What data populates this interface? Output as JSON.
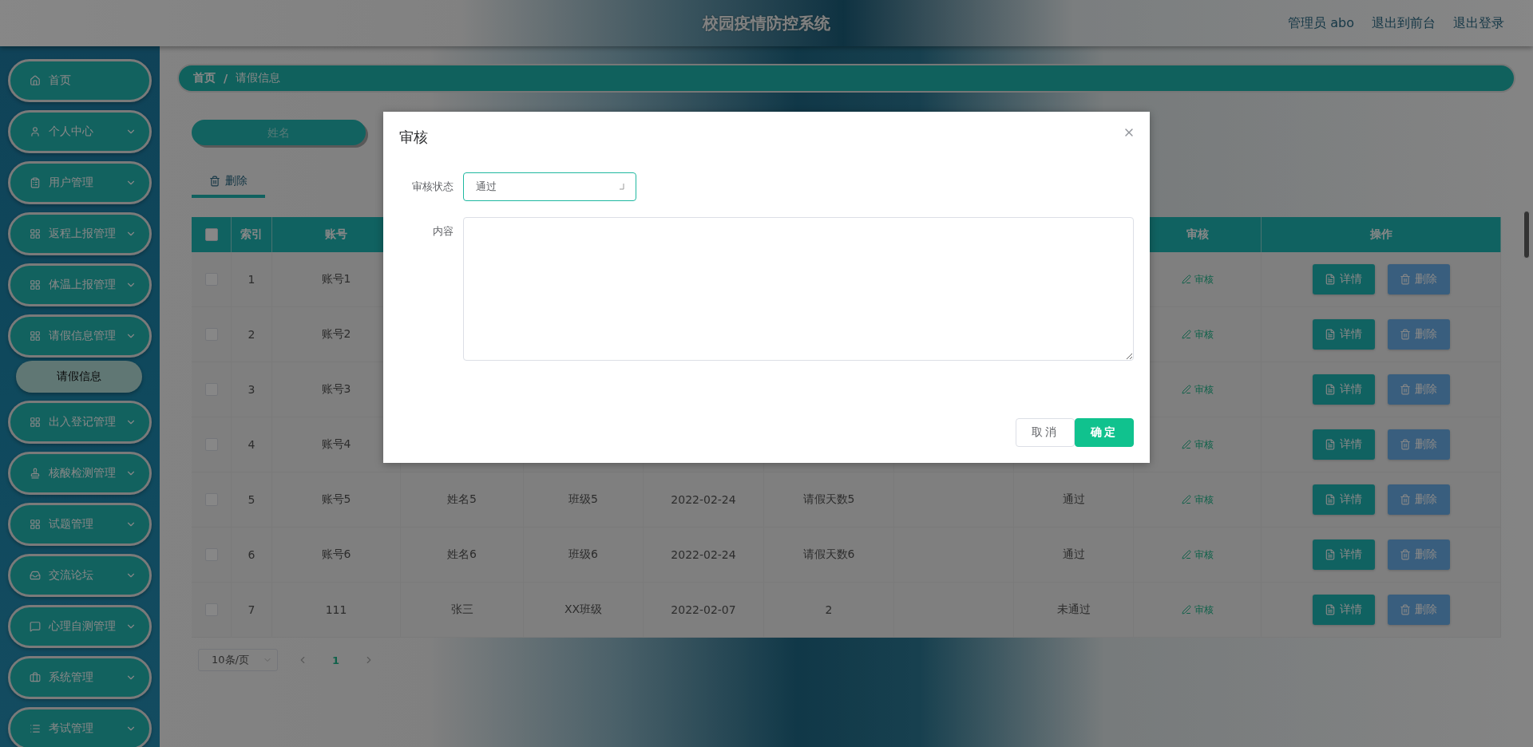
{
  "header": {
    "title": "校园疫情防控系统",
    "user": "管理员 abo",
    "links": [
      "退出到前台",
      "退出登录"
    ]
  },
  "sidebar": {
    "items": [
      {
        "label": "首页",
        "expandable": false
      },
      {
        "label": "个人中心",
        "expandable": true,
        "expanded": false
      },
      {
        "label": "用户管理",
        "expandable": true,
        "expanded": false
      },
      {
        "label": "返程上报管理",
        "expandable": true,
        "expanded": false
      },
      {
        "label": "体温上报管理",
        "expandable": true,
        "expanded": false
      },
      {
        "label": "请假信息管理",
        "expandable": true,
        "expanded": true,
        "children": [
          {
            "label": "请假信息",
            "selected": true
          }
        ]
      },
      {
        "label": "出入登记管理",
        "expandable": true,
        "expanded": false
      },
      {
        "label": "核酸检测管理",
        "expandable": true,
        "expanded": false
      },
      {
        "label": "试题管理",
        "expandable": true,
        "expanded": false
      },
      {
        "label": "交流论坛",
        "expandable": true,
        "expanded": false
      },
      {
        "label": "心理自测管理",
        "expandable": true,
        "expanded": false
      },
      {
        "label": "系统管理",
        "expandable": true,
        "expanded": false
      },
      {
        "label": "考试管理",
        "expandable": true,
        "expanded": false
      }
    ]
  },
  "breadcrumb": {
    "items": [
      "首页",
      "请假信息"
    ],
    "separator": "/"
  },
  "search": {
    "fields": [
      {
        "placeholder": "姓名"
      }
    ]
  },
  "toolbar": {
    "tabs": [
      {
        "label": "删除",
        "selected": true
      }
    ]
  },
  "table": {
    "select_all": {
      "checked": false
    },
    "columns": [
      {
        "kind": "text",
        "label": "索引"
      },
      {
        "kind": "text",
        "label": "账号"
      },
      {
        "kind": "text"
      },
      {
        "kind": "text"
      },
      {
        "kind": "text"
      },
      {
        "kind": "text"
      },
      {
        "kind": "text"
      },
      {
        "kind": "text"
      },
      {
        "kind": "review",
        "label": "审核"
      },
      {
        "kind": "actions",
        "label": "操作"
      }
    ],
    "rows": [
      {
        "checked": false,
        "cells": [
          "1",
          "账号1",
          null,
          null,
          null,
          null,
          null,
          null,
          "审核"
        ],
        "actions": [
          "详情",
          "删除"
        ]
      },
      {
        "checked": false,
        "cells": [
          "2",
          "账号2",
          null,
          null,
          null,
          null,
          null,
          null,
          "审核"
        ],
        "actions": [
          "详情",
          "删除"
        ]
      },
      {
        "checked": false,
        "cells": [
          "3",
          "账号3",
          null,
          null,
          null,
          null,
          null,
          null,
          "审核"
        ],
        "actions": [
          "详情",
          "删除"
        ]
      },
      {
        "checked": false,
        "cells": [
          "4",
          "账号4",
          null,
          null,
          null,
          null,
          null,
          null,
          "审核"
        ],
        "actions": [
          "详情",
          "删除"
        ]
      },
      {
        "checked": false,
        "cells": [
          "5",
          "账号5",
          "姓名5",
          "班级5",
          "2022-02-24",
          "请假天数5",
          null,
          "通过",
          "审核"
        ],
        "actions": [
          "详情",
          "删除"
        ]
      },
      {
        "checked": false,
        "cells": [
          "6",
          "账号6",
          "姓名6",
          "班级6",
          "2022-02-24",
          "请假天数6",
          null,
          "通过",
          "审核"
        ],
        "actions": [
          "详情",
          "删除"
        ]
      },
      {
        "checked": false,
        "cells": [
          "7",
          "111",
          "张三",
          "XX班级",
          "2022-02-07",
          "2",
          null,
          "未通过",
          "审核"
        ],
        "actions": [
          "详情",
          "删除"
        ]
      }
    ]
  },
  "pagination": {
    "page_size": "10条/页",
    "pages": [
      {
        "label": "1",
        "selected": true
      }
    ]
  },
  "dialog": {
    "title": "审核",
    "fields": [
      {
        "kind": "select",
        "label": "审核状态",
        "value": "通过"
      },
      {
        "kind": "textarea",
        "label": "内容"
      }
    ],
    "buttons": [
      {
        "kind": "default",
        "label": "取消"
      },
      {
        "kind": "primary",
        "label": "确定"
      }
    ]
  }
}
